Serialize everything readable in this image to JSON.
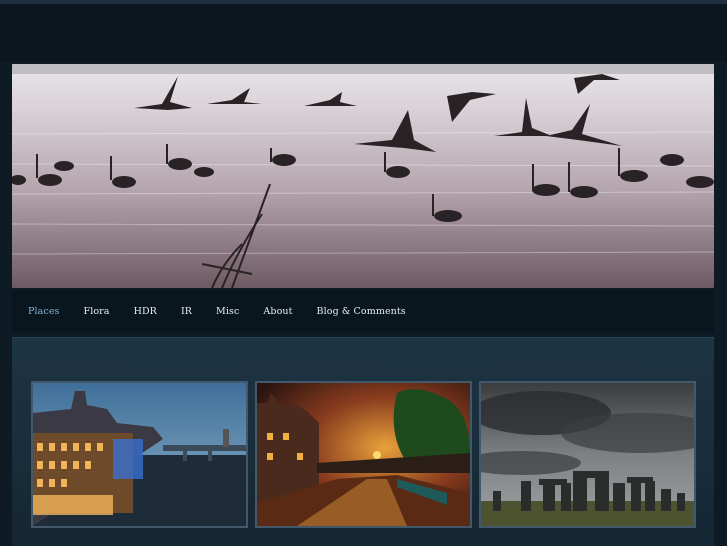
{
  "nav": {
    "items": [
      {
        "label": "Places",
        "active": true
      },
      {
        "label": "Flora",
        "active": false
      },
      {
        "label": "HDR",
        "active": false
      },
      {
        "label": "IR",
        "active": false
      },
      {
        "label": "Misc",
        "active": false
      },
      {
        "label": "About",
        "active": false
      },
      {
        "label": "Blog & Comments",
        "active": false
      }
    ]
  },
  "colors": {
    "page_background": "#0e1b24",
    "nav_background": "#0a161d",
    "active_nav": "#7fb3d8",
    "content_panel": "#1d3444"
  },
  "gallery": {
    "thumbnails": [
      {
        "subject": "city-waterfront-at-dusk"
      },
      {
        "subject": "canal-at-sunset"
      },
      {
        "subject": "stone-circle-storm-sky"
      }
    ]
  }
}
